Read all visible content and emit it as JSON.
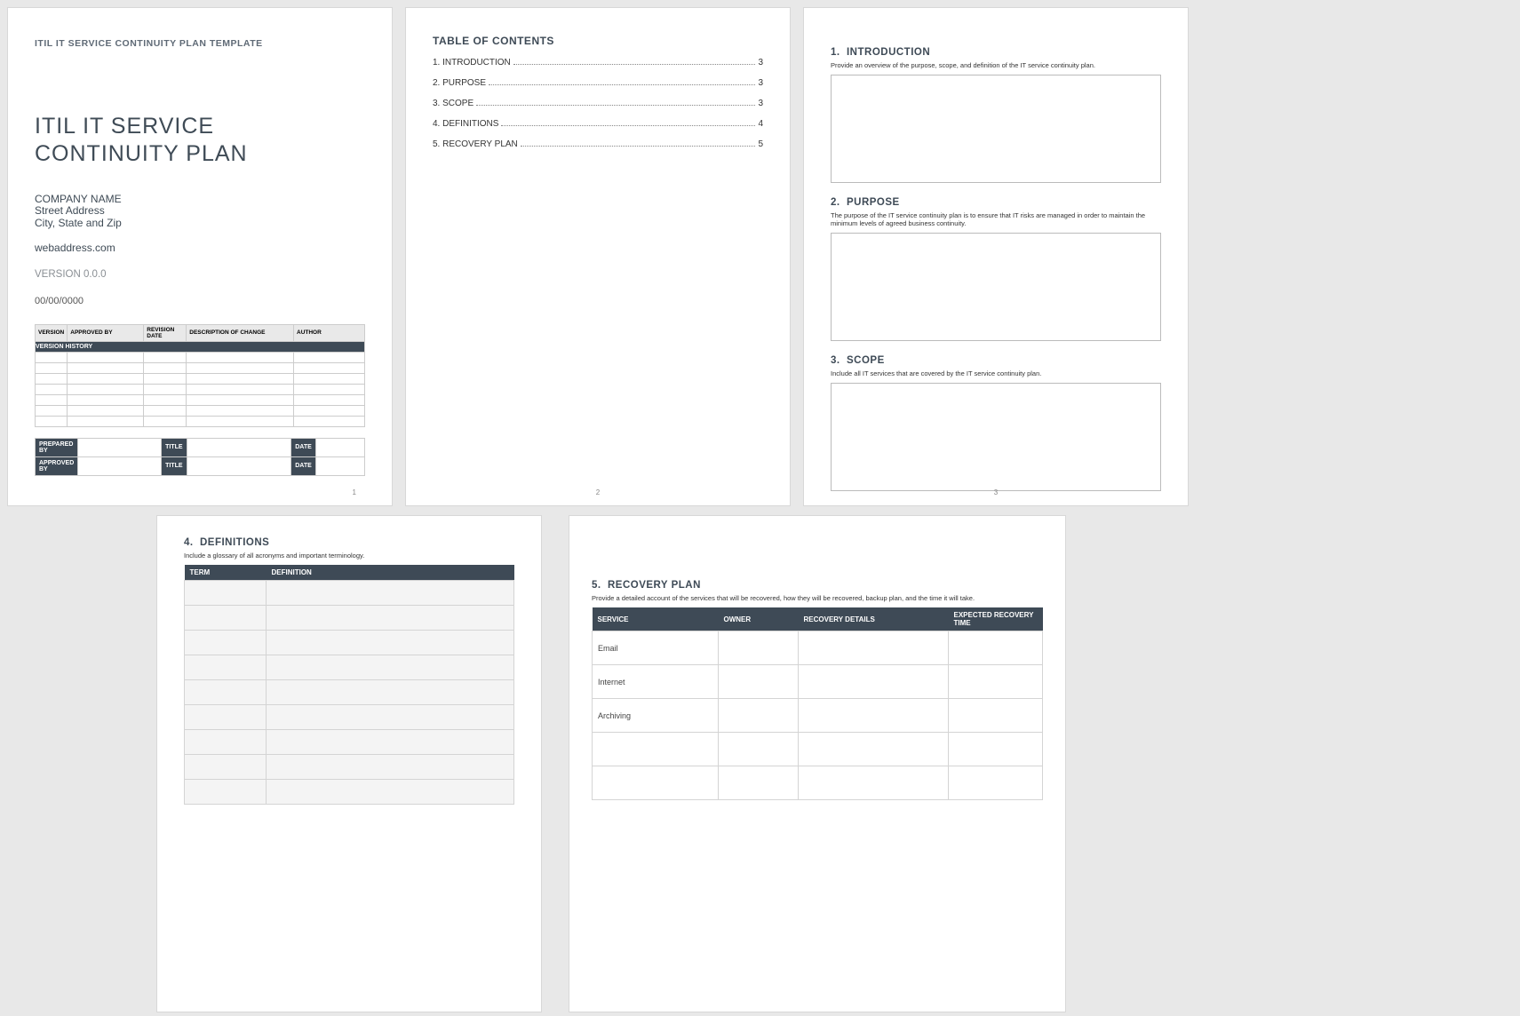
{
  "header": {
    "template_name": "ITIL IT SERVICE CONTINUITY PLAN TEMPLATE"
  },
  "title": "ITIL IT SERVICE CONTINUITY PLAN",
  "company": {
    "name": "COMPANY NAME",
    "street": "Street Address",
    "city_state_zip": "City, State and Zip",
    "web": "webaddress.com"
  },
  "version_label": "VERSION 0.0.0",
  "date_label": "00/00/0000",
  "version_history": {
    "title": "VERSION HISTORY",
    "columns": [
      "VERSION",
      "APPROVED BY",
      "REVISION DATE",
      "DESCRIPTION OF CHANGE",
      "AUTHOR"
    ],
    "row_count": 7
  },
  "signoff": {
    "row1": {
      "l1": "PREPARED BY",
      "l2": "TITLE",
      "l3": "DATE"
    },
    "row2": {
      "l1": "APPROVED BY",
      "l2": "TITLE",
      "l3": "DATE"
    }
  },
  "page_numbers": {
    "p1": "1",
    "p2": "2",
    "p3": "3"
  },
  "toc": {
    "title": "TABLE OF CONTENTS",
    "items": [
      {
        "label": "1. INTRODUCTION",
        "page": "3"
      },
      {
        "label": "2. PURPOSE",
        "page": "3"
      },
      {
        "label": "3. SCOPE",
        "page": "3"
      },
      {
        "label": "4. DEFINITIONS",
        "page": "4"
      },
      {
        "label": "5. RECOVERY PLAN",
        "page": "5"
      }
    ]
  },
  "sections": {
    "intro": {
      "num": "1.",
      "title": "INTRODUCTION",
      "desc": "Provide an overview of the purpose, scope, and definition of the IT service continuity plan."
    },
    "purpose": {
      "num": "2.",
      "title": "PURPOSE",
      "desc": "The purpose of the IT service continuity plan is to ensure that IT risks are managed in order to maintain the minimum levels of agreed business continuity."
    },
    "scope": {
      "num": "3.",
      "title": "SCOPE",
      "desc": "Include all IT services that are covered by the IT service continuity plan."
    },
    "definitions": {
      "num": "4.",
      "title": "DEFINITIONS",
      "desc": "Include a glossary of all acronyms and important terminology.",
      "columns": [
        "TERM",
        "DEFINITION"
      ],
      "row_count": 9
    },
    "recovery": {
      "num": "5.",
      "title": "RECOVERY PLAN",
      "desc": "Provide a detailed account of the services that will be recovered, how they will be recovered, backup plan, and the time it will take.",
      "columns": [
        "SERVICE",
        "OWNER",
        "RECOVERY DETAILS",
        "EXPECTED RECOVERY TIME"
      ],
      "services": [
        "Email",
        "Internet",
        "Archiving",
        "",
        ""
      ]
    }
  }
}
